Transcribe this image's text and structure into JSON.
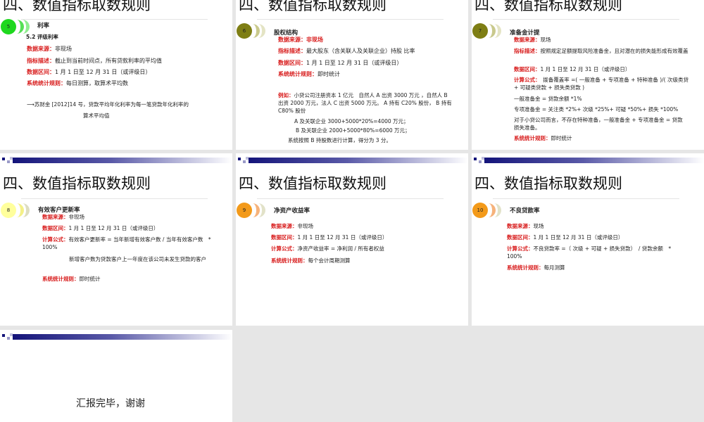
{
  "slide_title": "四、数值指标取数规则",
  "slides": [
    {
      "num": "5",
      "item": "利率",
      "sub": "5.2  评级利率",
      "lines": [
        {
          "l": "数据来源：",
          "v": "非现场"
        },
        {
          "l": "指标描述：",
          "v": "截止到当前时间点，所有贷款利率的平均值"
        },
        {
          "l": "数据区间：",
          "v": "1 月 1 日至 12 月 31 日（或评级日）"
        },
        {
          "l": "系统统计规则：",
          "v": "每日测算，取算术平均数"
        }
      ],
      "note1": "⟶苏财金 [2012]14 号，贷款平均年化利率为每一笔贷款年化利率的",
      "note2": "算术平均值"
    },
    {
      "num": "6",
      "item": "股权结构",
      "lines": [
        {
          "l": "数据来源：",
          "v": "非现场"
        },
        {
          "l": "指标描述：",
          "v": "最大股东（含关联人及关联企业）持股 比率"
        },
        {
          "l": "数据区间：",
          "v": "1 月 1 日至 12 月 31 日（或评级日）"
        },
        {
          "l": "系统统计规则：",
          "v": "即时统计"
        }
      ],
      "example_label": "例如：",
      "example": "小贷公司注册资本 1 亿元　自然人 A 出资 3000 万元 ，自然人 B 出资 2000 万元，法人 C 出资 5000 万元。 A 持有 C20% 股份， B 持有 C80% 股份",
      "calc_a": "A 及关联企业 3000+5000*20%=4000 万元；",
      "calc_b": "B 及关联企业 2000+5000*80%=6000 万元；",
      "result": "系统按照 B 持股数进行计算，得分为 3 分。"
    },
    {
      "num": "7",
      "item": "准备金计提",
      "lines": [
        {
          "l": "数据来源：",
          "v": "现场"
        },
        {
          "l": "指标描述：",
          "v": "按照规定足额提取风险准备金，且对潜在的损失能形成有效覆盖"
        },
        {
          "l": "数据区间：",
          "v": "1 月 1 日至 12 月 31 日（或评级日）"
        },
        {
          "l": "计算公式：",
          "v": "　拨备覆盖率 =( 一般准备 + 专项准备 + 特种准备 )/( 次级类贷 + 可疑类贷款 + 损失类贷款 )"
        }
      ],
      "general": "一般准备金 = 贷款余额 *1%",
      "special": "专项准备金 = 关注类 *2%+ 次级 *25%+ 可疑 *50%+ 损失 *100%",
      "note": "对于小贷公司而言，不存在特种准备，一般准备金 + 专项准备金 = 贷款损失准备。",
      "rule": {
        "l": "系统统计规则：",
        "v": "即时统计"
      }
    },
    {
      "num": "8",
      "item": "有效客户更新率",
      "lines": [
        {
          "l": "数据来源：",
          "v": "非现场"
        },
        {
          "l": "数据区间：",
          "v": "1 月 1 日至 12 月 31 日（或评级日）"
        },
        {
          "l": "计算公式：",
          "v": "有效客户更新率 = 当年新增有效客户数 / 当年有效客户数　* 100%"
        }
      ],
      "note": "新增客户数为贷款客户上一年度在该公司未发生贷款的客户",
      "rule": {
        "l": "系统统计规则：",
        "v": "即时统计"
      }
    },
    {
      "num": "9",
      "item": "净资产收益率",
      "lines": [
        {
          "l": "数据来源：",
          "v": "非现场"
        },
        {
          "l": "数据区间：",
          "v": "1 月 1 日至 12 月 31 日（或评级日）"
        },
        {
          "l": "计算公式：",
          "v": "净资产收益率 = 净利润 / 所有者权益"
        },
        {
          "l": "系统统计规则：",
          "v": "每个会计周期测算"
        }
      ]
    },
    {
      "num": "10",
      "item": "不良贷款率",
      "lines": [
        {
          "l": "数据来源：",
          "v": "现场"
        },
        {
          "l": "数据区间：",
          "v": "1 月 1 日至 12 月 31 日（或评级日）"
        },
        {
          "l": "计算公式：",
          "v": "不良贷款率 =（ 次级 + 可疑 + 损失贷款）　/ 贷款余额　* 100%"
        },
        {
          "l": "系统统计规则：",
          "v": "每月测算"
        }
      ]
    }
  ],
  "closing": "汇报完毕，谢谢",
  "colors": {
    "label": "#d81c1c",
    "bar": "#14147a"
  }
}
